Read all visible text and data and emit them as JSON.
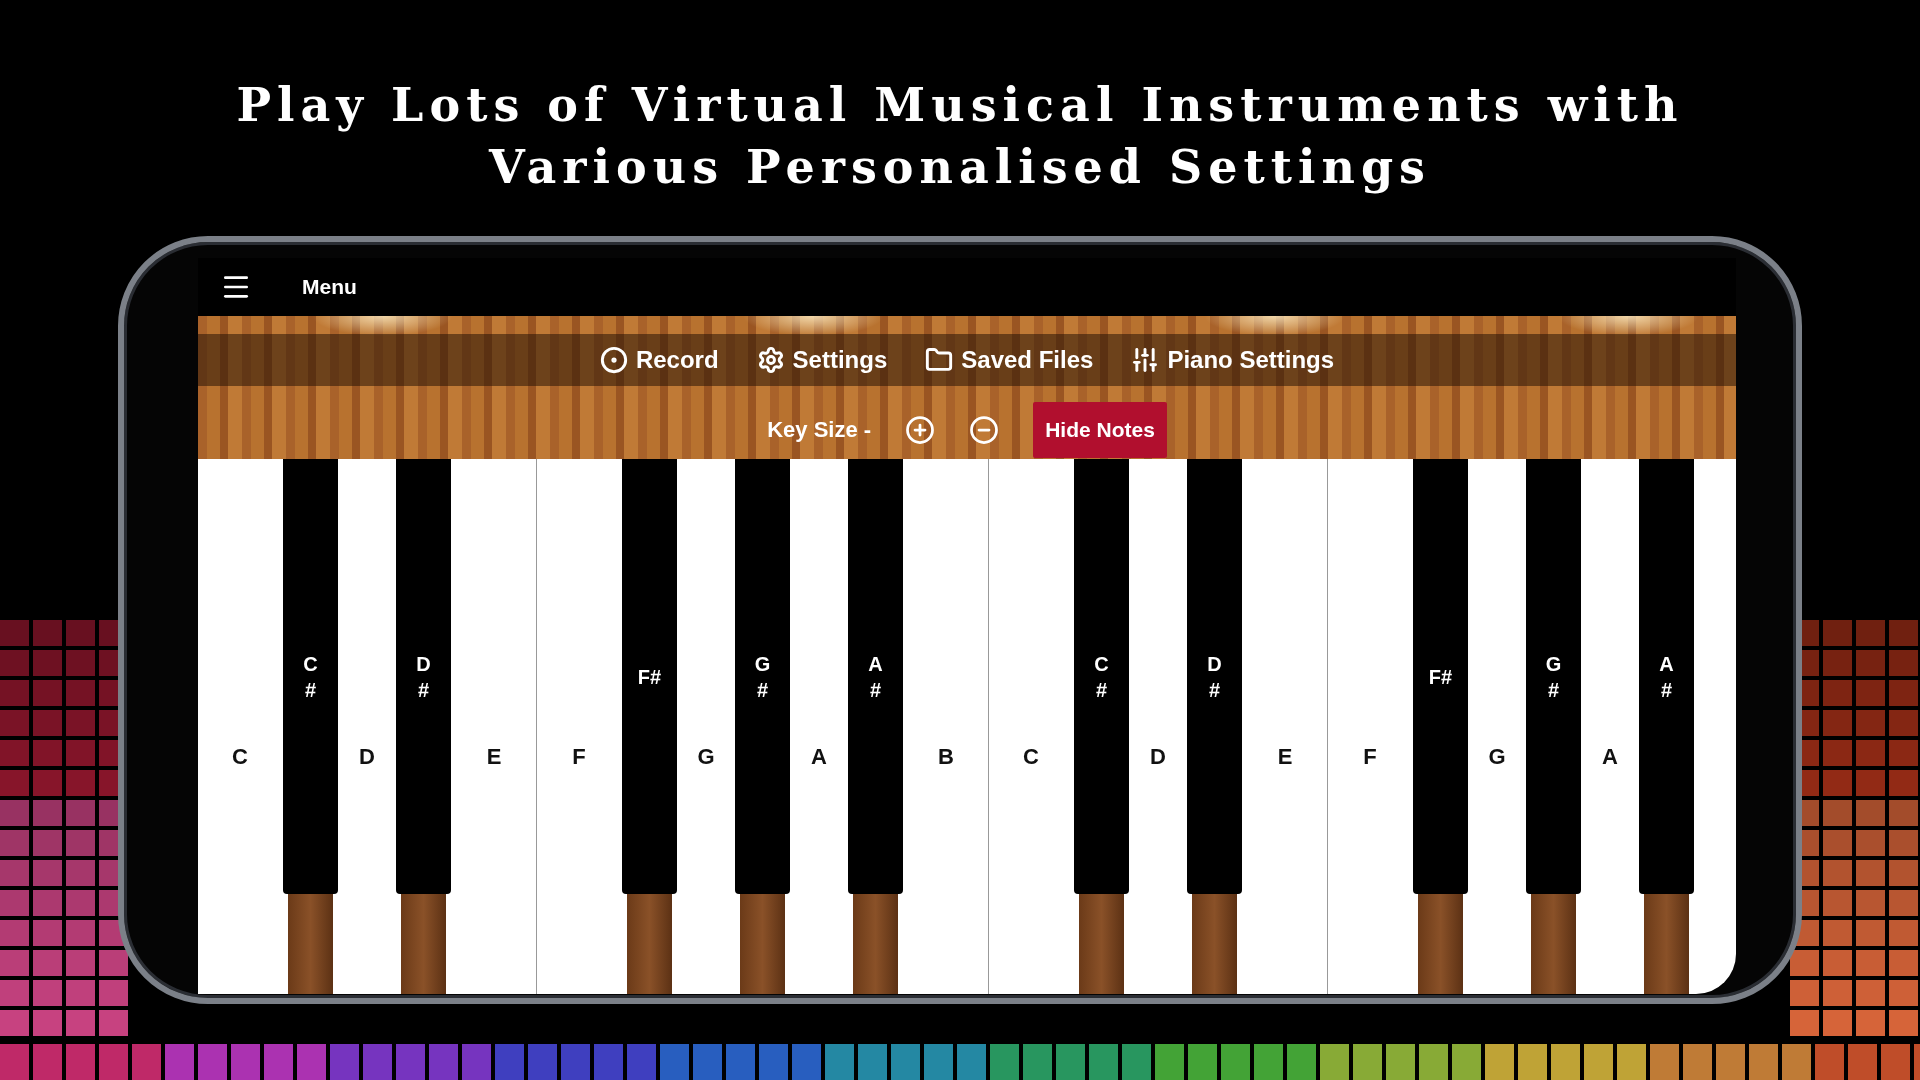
{
  "headline": [
    "Play Lots of Virtual Musical Instruments with",
    "Various Personalised Settings"
  ],
  "app_bar": {
    "title": "Menu"
  },
  "toolbar": [
    {
      "kind": "record",
      "label": "Record"
    },
    {
      "kind": "settings",
      "label": "Settings"
    },
    {
      "kind": "files",
      "label": "Saved Files"
    },
    {
      "kind": "piano",
      "label": "Piano Settings"
    }
  ],
  "key_size": {
    "label": "Key Size -"
  },
  "hide_notes_button": {
    "label": "Hide Notes"
  },
  "white_keys": [
    {
      "label": "C",
      "sharp": "C\n#"
    },
    {
      "label": "D",
      "sharp": "D\n#"
    },
    {
      "label": "E"
    },
    {
      "label": "F",
      "sharp": "F#"
    },
    {
      "label": "G",
      "sharp": "G\n#"
    },
    {
      "label": "A",
      "sharp": "A\n#"
    },
    {
      "label": "B"
    },
    {
      "label": "C",
      "sharp": "C\n#"
    },
    {
      "label": "D",
      "sharp": "D\n#"
    },
    {
      "label": "E"
    },
    {
      "label": "F",
      "sharp": "F#"
    },
    {
      "label": "G",
      "sharp": "G\n#"
    },
    {
      "label": "A",
      "sharp": "A\n#"
    }
  ]
}
